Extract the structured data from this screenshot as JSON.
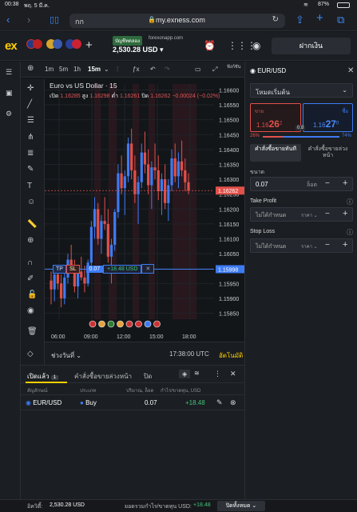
{
  "status": {
    "time": "00:38",
    "date": "พฤ. 5 มี.ค.",
    "battery": "87%"
  },
  "browser": {
    "aa": "กก",
    "url": "my.exness.com"
  },
  "header": {
    "logo": "ex",
    "account_badge": "บัญชีทดลอง",
    "account_server": "forexonapp.com",
    "balance": "2,530.28 USD",
    "deposit_label": "ฝากเงิน"
  },
  "chart_toolbar": {
    "timeframes": [
      "1m",
      "5m",
      "1h",
      "15m"
    ],
    "more": "ฟังก์ชัน"
  },
  "chart_data": {
    "type": "candlestick",
    "title": "Euro vs US Dollar · 15",
    "ohlc": {
      "open_label": "เปิด",
      "open": "1.16285",
      "high_label": "สูง",
      "high": "1.16298",
      "low_label": "ต่ำ",
      "low": "1.16261",
      "close_label": "ปิด",
      "close": "1.16262",
      "change": "−0.00024 (−0.02%)"
    },
    "y_ticks": [
      "1.16600",
      "1.16550",
      "1.16500",
      "1.16450",
      "1.16400",
      "1.16350",
      "1.16300",
      "1.16250",
      "1.16200",
      "1.16150",
      "1.16100",
      "1.16050",
      "1.16000",
      "1.15950",
      "1.15900",
      "1.15850"
    ],
    "ylim": [
      1.1583,
      1.1662
    ],
    "x_ticks": [
      "06:00",
      "09:00",
      "12:00",
      "15:00",
      "18:00"
    ],
    "current_price": "1.16262",
    "position_price": "1.15998",
    "candles": [
      [
        1.1596,
        1.1599,
        1.1588,
        1.1593
      ],
      [
        1.1593,
        1.16,
        1.1589,
        1.1598
      ],
      [
        1.1598,
        1.1601,
        1.1593,
        1.1595
      ],
      [
        1.1595,
        1.1598,
        1.1587,
        1.159
      ],
      [
        1.159,
        1.1599,
        1.1588,
        1.1597
      ],
      [
        1.1597,
        1.1605,
        1.1595,
        1.1603
      ],
      [
        1.1603,
        1.1608,
        1.1599,
        1.1601
      ],
      [
        1.1601,
        1.1603,
        1.1592,
        1.1594
      ],
      [
        1.1594,
        1.16,
        1.159,
        1.1599
      ],
      [
        1.1599,
        1.1604,
        1.1596,
        1.1597
      ],
      [
        1.1597,
        1.1601,
        1.1592,
        1.1595
      ],
      [
        1.1595,
        1.1603,
        1.1594,
        1.1602
      ],
      [
        1.1602,
        1.1616,
        1.1601,
        1.1614
      ],
      [
        1.1614,
        1.1624,
        1.161,
        1.162
      ],
      [
        1.162,
        1.1622,
        1.1608,
        1.161
      ],
      [
        1.161,
        1.1618,
        1.1605,
        1.1616
      ],
      [
        1.1616,
        1.1624,
        1.1613,
        1.1615
      ],
      [
        1.1615,
        1.162,
        1.1602,
        1.1604
      ],
      [
        1.1604,
        1.161,
        1.1595,
        1.1608
      ],
      [
        1.1608,
        1.162,
        1.1606,
        1.1619
      ],
      [
        1.1619,
        1.1635,
        1.1617,
        1.1632
      ],
      [
        1.1632,
        1.1638,
        1.1625,
        1.1627
      ],
      [
        1.1627,
        1.1633,
        1.1618,
        1.1631
      ],
      [
        1.1631,
        1.1644,
        1.1629,
        1.1642
      ],
      [
        1.1642,
        1.1647,
        1.163,
        1.1633
      ],
      [
        1.1633,
        1.1638,
        1.1622,
        1.1625
      ],
      [
        1.1625,
        1.1631,
        1.1615,
        1.1629
      ],
      [
        1.1629,
        1.1642,
        1.1627,
        1.1639
      ],
      [
        1.1639,
        1.1646,
        1.1632,
        1.1635
      ],
      [
        1.1635,
        1.164,
        1.1625,
        1.1628
      ],
      [
        1.1628,
        1.1636,
        1.162,
        1.1634
      ],
      [
        1.1634,
        1.1642,
        1.163,
        1.1633
      ],
      [
        1.1633,
        1.1638,
        1.1623,
        1.1626
      ],
      [
        1.1626,
        1.1632,
        1.1618,
        1.163
      ],
      [
        1.163,
        1.1635,
        1.162,
        1.1622
      ],
      [
        1.1622,
        1.163,
        1.1616,
        1.1628
      ],
      [
        1.1628,
        1.164,
        1.1626,
        1.1637
      ],
      [
        1.1637,
        1.1642,
        1.1629,
        1.1631
      ],
      [
        1.1631,
        1.1639,
        1.1627,
        1.1636
      ],
      [
        1.1636,
        1.1643,
        1.1631,
        1.1633
      ],
      [
        1.1633,
        1.1637,
        1.1626,
        1.1629
      ],
      [
        1.1629,
        1.1632,
        1.1625,
        1.16262
      ]
    ]
  },
  "chart_bottom": {
    "range_label": "ช่วงวันที่",
    "clock": "17:38:00 UTC",
    "auto_label": "อัตโนมัติ"
  },
  "position_line": {
    "tp": "TP",
    "sl": "SL",
    "lots": "0.07",
    "pl": "+18.48 USD",
    "close": "✕"
  },
  "order_panel": {
    "symbol": "EUR/USD",
    "mode": "โหมดเริ่มต้น",
    "sell_label": "ขาย",
    "sell_price_main": "1.16",
    "sell_price_big": "26",
    "sell_price_sup": "2",
    "buy_label": "ซื้อ",
    "buy_price_main": "1.16",
    "buy_price_big": "27",
    "buy_price_sup": "0",
    "spread": "0.8",
    "sentiment_sell": "26%",
    "sentiment_buy": "74%",
    "tab_market": "คำสั่งซื้อขายทันที",
    "tab_pending": "คำสั่งซื้อขายล่วงหน้า",
    "volume_label": "ขนาด",
    "volume_value": "0.07",
    "volume_unit": "ล็อต",
    "tp_label": "Take Profit",
    "tp_value": "ไม่ได้กำหนด",
    "tp_unit": "ราคา",
    "sl_label": "Stop Loss",
    "sl_value": "ไม่ได้กำหนด",
    "sl_unit": "ราคา"
  },
  "positions": {
    "tab_open": "เปิดแล้ว",
    "tab_open_count": "1",
    "tab_pending": "คำสั่งซื้อขายล่วงหน้า",
    "tab_closed": "ปิด",
    "col_symbol": "สัญลักษณ์",
    "col_type": "ประเภท",
    "col_volume": "ปริมาณ, ล็อต",
    "col_pl": "กำไร/ขาดทุน, USD",
    "rows": [
      {
        "symbol": "EUR/USD",
        "type": "Buy",
        "volume": "0.07",
        "pl": "+18.48"
      }
    ]
  },
  "footer": {
    "equity_label": "อิควิตี้:",
    "equity": "2,530.28 USD",
    "total_label": "ยอดรวมกำไร/ขาดทุน USD:",
    "total": "+18.48",
    "close_all": "ปิดทั้งหมด"
  },
  "colors": {
    "bull": "#3d7bf3",
    "bear": "#e2504a",
    "accent": "#ffcf00"
  }
}
